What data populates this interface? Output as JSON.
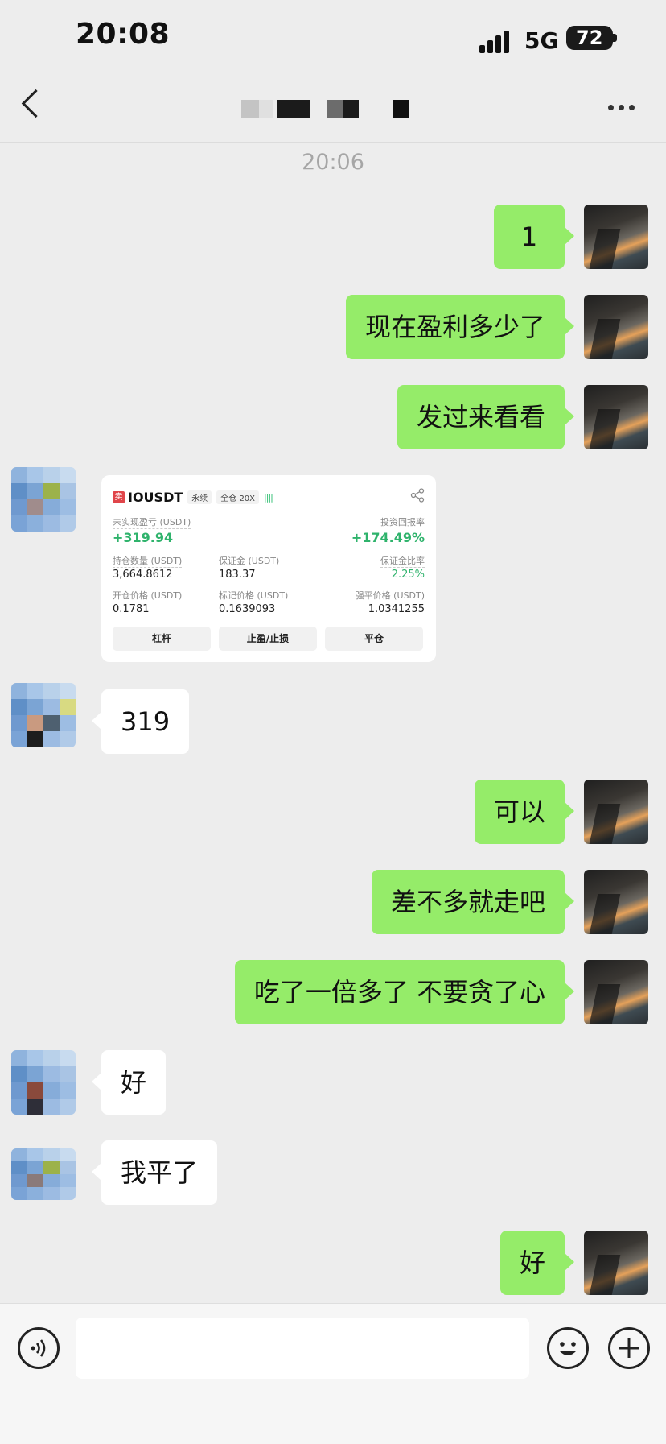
{
  "status_bar": {
    "time": "20:08",
    "network": "5G",
    "battery": "72"
  },
  "header": {
    "title": ""
  },
  "timestamp": "20:06",
  "messages": [
    {
      "from": "me",
      "text": "1"
    },
    {
      "from": "me",
      "text": "现在盈利多少了"
    },
    {
      "from": "me",
      "text": "发过来看看"
    },
    {
      "from": "them",
      "type": "trade-card"
    },
    {
      "from": "them",
      "text": "319"
    },
    {
      "from": "me",
      "text": "可以"
    },
    {
      "from": "me",
      "text": "差不多就走吧"
    },
    {
      "from": "me",
      "text": "吃了一倍多了 不要贪了心"
    },
    {
      "from": "them",
      "text": "好"
    },
    {
      "from": "them",
      "text": "我平了"
    },
    {
      "from": "me",
      "text": "好"
    }
  ],
  "trade_card": {
    "side_tag": "卖",
    "symbol": "IOUSDT",
    "type_chip": "永续",
    "margin_chip": "全仓 20X",
    "unrealized_label": "未实现盈亏 (USDT)",
    "unrealized_value": "+319.94",
    "roi_label": "投资回报率",
    "roi_value": "+174.49%",
    "qty_label": "持仓数量 (USDT)",
    "qty_value": "3,664.8612",
    "margin_label": "保证金 (USDT)",
    "margin_value": "183.37",
    "margin_ratio_label": "保证金比率",
    "margin_ratio_value": "2.25%",
    "entry_label": "开仓价格 (USDT)",
    "entry_value": "0.1781",
    "mark_label": "标记价格 (USDT)",
    "mark_value": "0.1639093",
    "liq_label": "强平价格 (USDT)",
    "liq_value": "1.0341255",
    "buttons": [
      "杠杆",
      "止盈/止损",
      "平仓"
    ]
  },
  "colors": {
    "bubble_me": "#95ec69",
    "bubble_them": "#ffffff",
    "profit_green": "#2fb36c"
  },
  "icons": [
    "back-icon",
    "more-icon",
    "voice-icon",
    "emoji-icon",
    "plus-icon",
    "share-icon"
  ]
}
